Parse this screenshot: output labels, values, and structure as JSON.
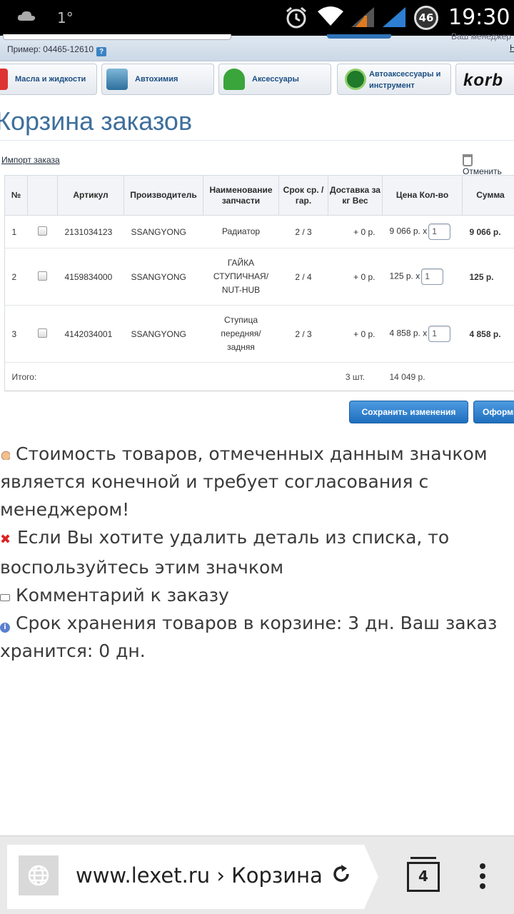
{
  "status_bar": {
    "temperature": "1°",
    "battery": "46",
    "time": "19:30"
  },
  "header": {
    "example_text": "Пример: 04465-12610",
    "help_mark": "?",
    "manager_text": "Ваш менеджер",
    "partial_link": "Н"
  },
  "categories": [
    {
      "label": "Масла и жидкости",
      "icon": "oil-icon"
    },
    {
      "label": "Автохимия",
      "icon": "autochemistry-icon"
    },
    {
      "label": "Аксессуары",
      "icon": "accessories-icon"
    },
    {
      "label": "Автоаксессуары и инструмент",
      "icon": "tools-icon"
    },
    {
      "label": "korb",
      "icon": "brand-logo"
    }
  ],
  "page": {
    "title": "Корзина заказов",
    "import_link": "Импорт заказа",
    "cancel_link": "Отменить"
  },
  "table": {
    "headers": {
      "num": "№",
      "article": "Артикул",
      "manufacturer": "Производитель",
      "name": "Наименование запчасти",
      "term": "Срок ср. / гар.",
      "delivery": "Доставка за кг Вес",
      "price": "Цена Кол-во",
      "sum": "Сумма"
    },
    "rows": [
      {
        "num": "1",
        "article": "2131034123",
        "manufacturer": "SSANGYONG",
        "name": "Радиатор",
        "term": "2 / 3",
        "delivery": "+ 0 р.",
        "price": "9 066 р. x",
        "qty": "1",
        "sum": "9 066 р."
      },
      {
        "num": "2",
        "article": "4159834000",
        "manufacturer": "SSANGYONG",
        "name": "ГАЙКА СТУПИЧНАЯ/ NUT-HUB",
        "term": "2 / 4",
        "delivery": "+ 0 р.",
        "price": "125 р. x",
        "qty": "1",
        "sum": "125 р."
      },
      {
        "num": "3",
        "article": "4142034001",
        "manufacturer": "SSANGYONG",
        "name": "Ступица передняя/ задняя",
        "term": "2 / 3",
        "delivery": "+ 0 р.",
        "price": "4 858 р. x",
        "qty": "1",
        "sum": "4 858 р."
      }
    ],
    "total": {
      "label": "Итого:",
      "count": "3 шт.",
      "amount": "14 049 р."
    }
  },
  "buttons": {
    "save": "Сохранить изменения",
    "order": "Оформить"
  },
  "notes": [
    {
      "icon": "hand-icon",
      "text": "Стоимость товаров, отмеченных данным значком является конечной и требует согласования с менеджером!"
    },
    {
      "icon": "cross-icon",
      "text": "Если Вы хотите удалить деталь из списка, то воспользуйтесь этим значком"
    },
    {
      "icon": "comment-icon",
      "text": "Комментарий к заказу"
    },
    {
      "icon": "info-icon",
      "text": "Срок хранения товаров в корзине: 3 дн. Ваш заказ хранится: 0 дн."
    }
  ],
  "browser": {
    "url": "www.lexet.ru › Корзина заказов",
    "tabs_count": "4"
  },
  "colors": {
    "title": "#3e6f9c",
    "button": "#2e7fcf",
    "link": "#1d4f84"
  }
}
